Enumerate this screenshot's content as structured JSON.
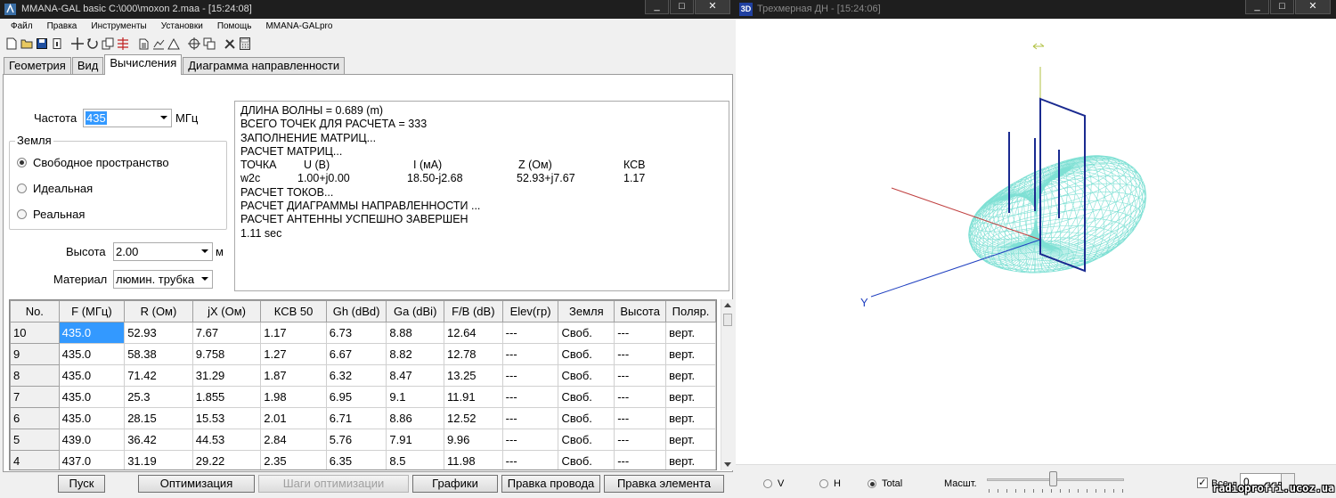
{
  "main_window": {
    "title": "MMANA-GAL basic  C:\\000\\moxon 2.maa - [15:24:08]",
    "controls": {
      "minimize": "_",
      "maximize": "□",
      "close": "✕"
    },
    "menu": [
      "Файл",
      "Правка",
      "Инструменты",
      "Установки",
      "Помощь",
      "MMANA-GALpro"
    ],
    "toolbar_icons": [
      "new-file-icon",
      "open-folder-icon",
      "save-icon",
      "info-icon",
      "move-icon",
      "rotate-icon",
      "copy-icon",
      "wire-edit-icon",
      "document-icon",
      "chart-icon",
      "triangle-icon",
      "target-icon",
      "clone-icon",
      "tools-icon",
      "calculator-icon"
    ],
    "tabs": [
      {
        "label": "Геометрия",
        "active": false
      },
      {
        "label": "Вид",
        "active": false
      },
      {
        "label": "Вычисления",
        "active": true
      },
      {
        "label": "Диаграмма направленности",
        "active": false
      }
    ],
    "calc": {
      "freq_label": "Частота",
      "freq_value": "435",
      "freq_unit": "МГц",
      "ground_title": "Земля",
      "ground_options": [
        {
          "label": "Свободное пространство",
          "checked": true
        },
        {
          "label": "Идеальная",
          "checked": false
        },
        {
          "label": "Реальная",
          "checked": false
        }
      ],
      "height_label": "Высота",
      "height_value": "2.00",
      "height_unit": "м",
      "material_label": "Материал",
      "material_value": "люмин. трубка"
    },
    "output_lines": [
      "ДЛИНА ВОЛНЫ = 0.689 (m)",
      "ВСЕГО ТОЧЕК ДЛЯ РАСЧЕТА = 333",
      "ЗАПОЛНЕНИЕ МАТРИЦ...",
      "РАСЧЕТ МАТРИЦ..."
    ],
    "output_table": {
      "headers": [
        "ТОЧКА",
        "U (В)",
        "I (мА)",
        "Z (Ом)",
        "КСВ"
      ],
      "row": [
        "w2c",
        "1.00+j0.00",
        "18.50-j2.68",
        "52.93+j7.67",
        "1.17"
      ]
    },
    "output_lines_after": [
      "РАСЧЕТ ТОКОВ...",
      "РАСЧЕТ ДИАГРАММЫ НАПРАВЛЕННОСТИ ...",
      "РАСЧЕТ АНТЕННЫ УСПЕШНО ЗАВЕРШЕН",
      "1.11 sec"
    ],
    "results": {
      "columns": [
        "No.",
        "F (МГц)",
        "R (Ом)",
        "jX (Ом)",
        "КСВ 50",
        "Gh (dBd)",
        "Ga (dBi)",
        "F/B (dB)",
        "Elev(гр)",
        "Земля",
        "Высота",
        "Поляр."
      ],
      "rows": [
        [
          "10",
          "435.0",
          "52.93",
          "7.67",
          "1.17",
          "6.73",
          "8.88",
          "12.64",
          "---",
          "Своб.",
          "---",
          "верт."
        ],
        [
          "9",
          "435.0",
          "58.38",
          "9.758",
          "1.27",
          "6.67",
          "8.82",
          "12.78",
          "---",
          "Своб.",
          "---",
          "верт."
        ],
        [
          "8",
          "435.0",
          "71.42",
          "31.29",
          "1.87",
          "6.32",
          "8.47",
          "13.25",
          "---",
          "Своб.",
          "---",
          "верт."
        ],
        [
          "7",
          "435.0",
          "25.3",
          "1.855",
          "1.98",
          "6.95",
          "9.1",
          "11.91",
          "---",
          "Своб.",
          "---",
          "верт."
        ],
        [
          "6",
          "435.0",
          "28.15",
          "15.53",
          "2.01",
          "6.71",
          "8.86",
          "12.52",
          "---",
          "Своб.",
          "---",
          "верт."
        ],
        [
          "5",
          "439.0",
          "36.42",
          "44.53",
          "2.84",
          "5.76",
          "7.91",
          "9.96",
          "---",
          "Своб.",
          "---",
          "верт."
        ],
        [
          "4",
          "437.0",
          "31.19",
          "29.22",
          "2.35",
          "6.35",
          "8.5",
          "11.98",
          "---",
          "Своб.",
          "---",
          "верт."
        ]
      ]
    },
    "buttons": [
      {
        "label": "Пуск",
        "enabled": true
      },
      {
        "label": "Оптимизация",
        "enabled": true
      },
      {
        "label": "Шаги оптимизации",
        "enabled": false
      },
      {
        "label": "Графики",
        "enabled": true
      },
      {
        "label": "Правка провода",
        "enabled": true
      },
      {
        "label": "Правка элемента",
        "enabled": true
      }
    ]
  },
  "pattern_window": {
    "title": "Трехмерная ДН - [15:24:06]",
    "app_icon_text": "3D",
    "axis_y_label": "Y",
    "mesh_color": "#7ee0d4",
    "view_options": [
      {
        "label": "V",
        "checked": false
      },
      {
        "label": "H",
        "checked": false
      },
      {
        "label": "Total",
        "checked": true
      }
    ],
    "scale_label": "Масшт.",
    "scale_level": 0.48,
    "all_label": "Все",
    "all_checked": true,
    "spin_value": "0",
    "watermark": "radioproffi.ucoz.ua"
  }
}
